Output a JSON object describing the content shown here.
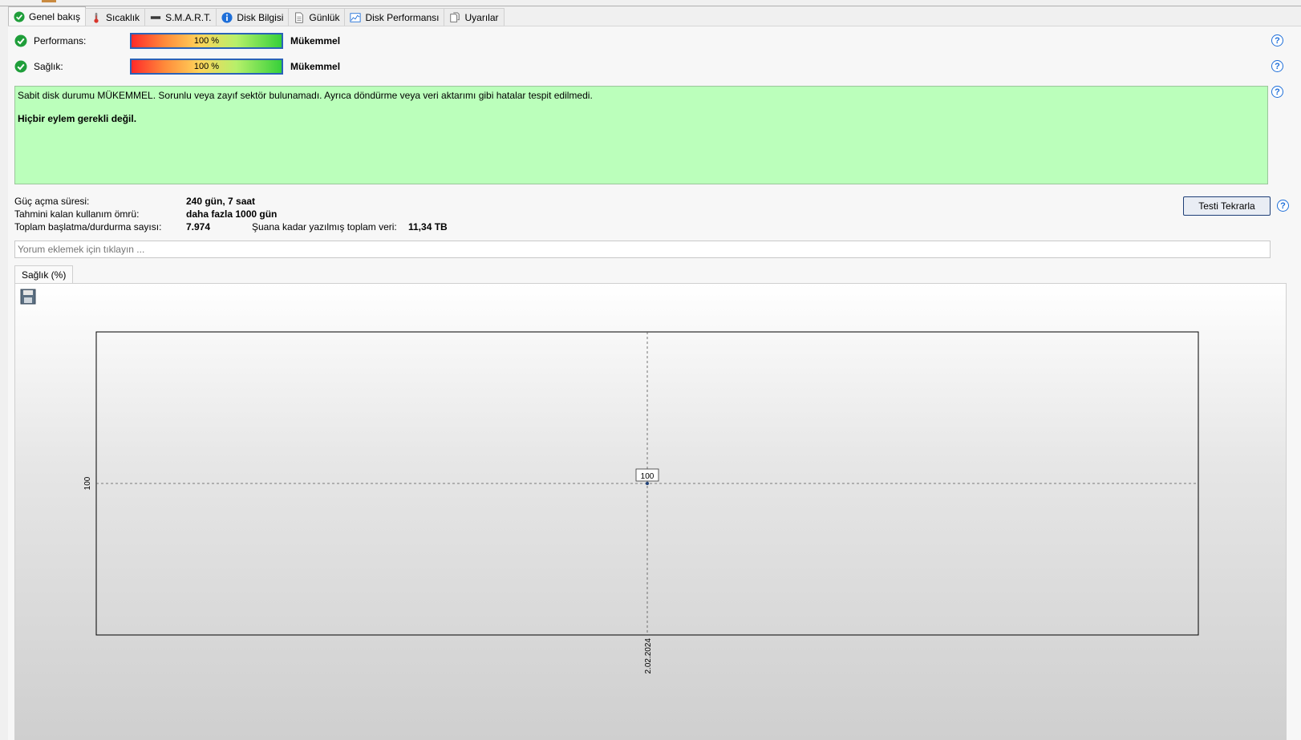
{
  "tabs": [
    {
      "label": "Genel bakış",
      "icon": "check-circle-icon"
    },
    {
      "label": "Sıcaklık",
      "icon": "thermometer-icon"
    },
    {
      "label": "S.M.A.R.T.",
      "icon": "drive-icon"
    },
    {
      "label": "Disk Bilgisi",
      "icon": "info-icon"
    },
    {
      "label": "Günlük",
      "icon": "document-icon"
    },
    {
      "label": "Disk Performansı",
      "icon": "performance-chart-icon"
    },
    {
      "label": "Uyarılar",
      "icon": "alerts-icon"
    }
  ],
  "performance": {
    "label": "Performans:",
    "bar_text": "100 %",
    "percent": 100,
    "rating": "Mükemmel"
  },
  "health": {
    "label": "Sağlık:",
    "bar_text": "100 %",
    "percent": 100,
    "rating": "Mükemmel"
  },
  "status": {
    "message": "Sabit disk durumu MÜKEMMEL. Sorunlu veya zayıf sektör bulunamadı. Ayrıca döndürme veya veri aktarımı gibi hatalar tespit edilmedi.",
    "action": "Hiçbir eylem gerekli değil.",
    "background": "#bbffbb"
  },
  "stats": {
    "power_on_label": "Güç açma süresi:",
    "power_on_value": "240 gün, 7 saat",
    "lifetime_label": "Tahmini kalan kullanım ömrü:",
    "lifetime_value": "daha fazla 1000 gün",
    "startstop_label": "Toplam başlatma/durdurma sayısı:",
    "startstop_value": "7.974",
    "written_label": "Şuana kadar yazılmış toplam veri:",
    "written_value": "11,34 TB"
  },
  "retest_button": "Testi Tekrarla",
  "comment": {
    "placeholder": "Yorum eklemek için tıklayın ..."
  },
  "chart_tab": "Sağlık (%)",
  "chart_data": {
    "type": "line",
    "x": [
      "2.02.2024"
    ],
    "series": [
      {
        "values": [
          100
        ]
      }
    ],
    "x_tick_labels": [
      "2.02.2024"
    ],
    "y_tick_labels": [
      "100"
    ],
    "data_labels": [
      "100"
    ],
    "grid": true
  },
  "colors": {
    "accent": "#1e6fd9",
    "ok_green": "#1f9e3a",
    "bar_border": "#2a62b8"
  }
}
